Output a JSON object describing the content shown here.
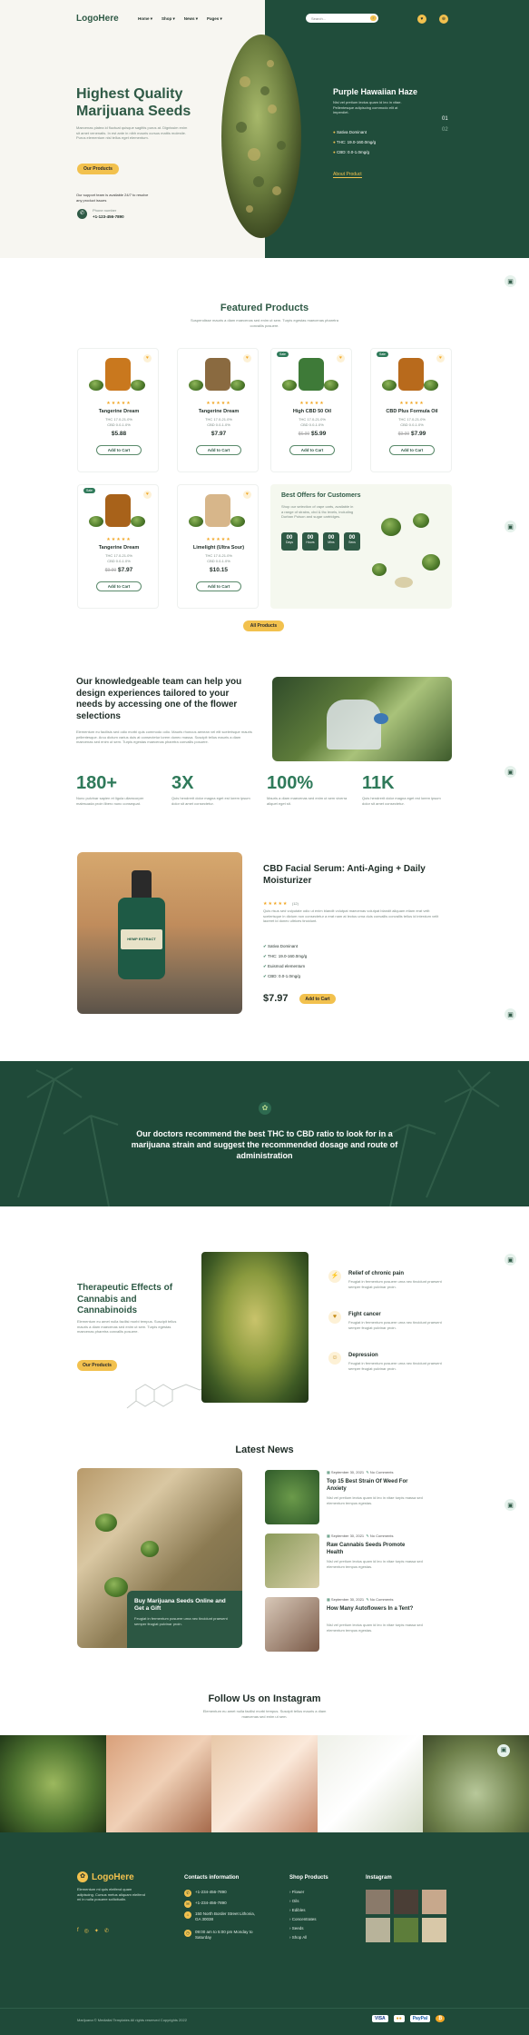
{
  "header": {
    "logo": "LogoHere",
    "nav": [
      "Home ▾",
      "Shop ▾",
      "News ▾",
      "Pages ▾"
    ],
    "search_placeholder": "Search..."
  },
  "hero": {
    "title_line1": "Highest Quality",
    "title_line2": "Marijuana Seeds",
    "desc": "Maecenas platea id fluctuat quisque sagittis purus at. Dignissim enim sit amet venenatis. In est ante in nibh mauris cursus mattis molestie. Purus elementum nisl tellus eget elementum.",
    "cta": "Our Products",
    "support": "Our support team is available 24/7 to resolve any product issues",
    "phone_label": "Phone number",
    "phone": "+1-123-456-7890",
    "product_title": "Purple Hawaiian Haze",
    "product_desc": "Nisl vel pretium lectus quam id leo in vitae. Pellentesque adipiscing commodo elit at imperdiet.",
    "features": [
      "Sativa Dominant",
      "THC: 19.0-160.0mg/g",
      "CBD: 0.0-1.0mg/g"
    ],
    "about": "About Product",
    "slide_current": "01",
    "slide_next": "02"
  },
  "featured": {
    "title": "Featured Products",
    "subtitle": "Suspendisse mauris a diam maecenas sed enim ut sem. Turpis egestas maecenas pharetra convallis posuere.",
    "products": [
      {
        "name": "Tangerine Dream",
        "thc": "THC 17.0-21.0%",
        "cbd": "CBD 0.0-1.0%",
        "price": "$5.88",
        "old": "",
        "badge": "",
        "button": "Add to Cart"
      },
      {
        "name": "Tangerine Dream",
        "thc": "THC 17.0-21.0%",
        "cbd": "CBD 0.0-1.0%",
        "price": "$7.97",
        "old": "",
        "badge": "",
        "button": "Add to Cart"
      },
      {
        "name": "High CBD 50 Oil",
        "thc": "THC 17.0-21.0%",
        "cbd": "CBD 0.0-1.0%",
        "price": "$5.99",
        "old": "$6.99",
        "badge": "Sale",
        "button": "Add to Cart"
      },
      {
        "name": "CBD Plus Formula Oil",
        "thc": "THC 17.0-21.0%",
        "cbd": "CBD 0.0-1.0%",
        "price": "$7.99",
        "old": "$9.99",
        "badge": "Sale",
        "button": "Add to Cart"
      },
      {
        "name": "Tangerine Dream",
        "thc": "THC 17.0-21.0%",
        "cbd": "CBD 0.0-1.0%",
        "price": "$7.97",
        "old": "$9.99",
        "badge": "Sale",
        "button": "Add to Cart"
      },
      {
        "name": "Limelight (Ultra Sour)",
        "thc": "THC 17.0-21.0%",
        "cbd": "CBD 0.0-1.0%",
        "price": "$10.15",
        "old": "",
        "badge": "",
        "button": "Add to Cart"
      }
    ],
    "offer": {
      "title": "Best Offers for Customers",
      "desc": "Shop our selection of vape carts, available in a range of strains, cbd & thc levels, including Durban Poison and sugar cartridges.",
      "timer": [
        {
          "v": "00",
          "l": "Days"
        },
        {
          "v": "00",
          "l": "Hours"
        },
        {
          "v": "00",
          "l": "Mins"
        },
        {
          "v": "00",
          "l": "Secs"
        }
      ]
    },
    "all_button": "All Products"
  },
  "team": {
    "title": "Our knowledgeable team can help you design experiences tailored to your needs by accessing one of the flower selections",
    "desc": "Elementum eu facilisis sed odio morbi quis commodo odio. Mauris rhoncus aenean vel elit scelerisque mauris pellentesque. Arcu dictum varius duis at consectetur lorem donec massa. Suscipit tellus mauris a diam maecenas sed enim ut sem. Turpis egestas maecenas pharetra convallis posuere.",
    "stats": [
      {
        "num": "180+",
        "text": "Nunc pulvinar sapien et ligula ullamcorper malesuada proin libero nunc consequat."
      },
      {
        "num": "3X",
        "text": "Quis hendrerit dolor magna eget est lorem ipsum dolor sit amet consectetur."
      },
      {
        "num": "100%",
        "text": "Mauris a diam maecenas sed enim ut sem viverra aliquet eget sit."
      },
      {
        "num": "11K",
        "text": "Quis hendrerit dolor magna eget est lorem ipsum dolor sit amet consectetur."
      }
    ]
  },
  "serum": {
    "title": "CBD Facial Serum: Anti-Aging + Daily Moisturizer",
    "reviews": "(12)",
    "desc": "Quis risus sed vulputate odio ut enim blandit volutpat maecenas volutpat blandit aliquam etiam erat velit scelerisque in dictum non consectetur a erat nam at lectus urna duis convallis convallis tellus id interdum velit laoreet id donec ultrices tincidunt.",
    "features": [
      "Sativa Dominant",
      "THC: 19.0-160.0mg/g",
      "Euismod elementum",
      "CBD: 0.0-1.0mg/g"
    ],
    "price": "$7.97",
    "button": "Add to Cart",
    "label": "HEMP EXTRACT"
  },
  "doctors": {
    "text": "Our doctors recommend the best THC to CBD ratio to look for in a marijuana strain and suggest the recommended dosage and route of administration"
  },
  "effects": {
    "title": "Therapeutic Effects of Cannabis and Cannabinoids",
    "desc": "Elementum eu amet nulla facilisi morbi tempus. Suscipit tellus mauris a diam maecenas sed enim ut sem. Turpis egestas maecenas pharetra convallis posuere.",
    "button": "Our Products",
    "items": [
      {
        "title": "Relief of chronic pain",
        "desc": "Feugiat in fermentum posuere urna nec tincidunt praesent semper feugiat pulvinar proin."
      },
      {
        "title": "Fight cancer",
        "desc": "Feugiat in fermentum posuere urna nec tincidunt praesent semper feugiat pulvinar proin."
      },
      {
        "title": "Depression",
        "desc": "Feugiat in fermentum posuere urna nec tincidunt praesent semper feugiat pulvinar proin."
      }
    ]
  },
  "news": {
    "title": "Latest News",
    "main_title": "Buy Marijuana Seeds Online and Get a Gift",
    "main_desc": "Feugiat in fermentum posuere urna nec tincidunt praesent semper feugiat pulvinar proin.",
    "items": [
      {
        "date": "September 30, 2021",
        "comments": "No Comments",
        "title": "Top 15 Best Strain Of Weed For Anxiety",
        "desc": "Nisl vel pretium lectus quam id leo in vitae turpis massa sed elementum tempus egestas."
      },
      {
        "date": "September 30, 2021",
        "comments": "No Comments",
        "title": "Raw Cannabis Seeds Promote Health",
        "desc": "Nisl vel pretium lectus quam id leo in vitae turpis massa sed elementum tempus egestas."
      },
      {
        "date": "September 30, 2021",
        "comments": "No Comments",
        "title": "How Many Autoflowers In a Tent?",
        "desc": "Nisl vel pretium lectus quam id leo in vitae turpis massa sed elementum tempus egestas."
      }
    ]
  },
  "instagram": {
    "title": "Follow Us on Instagram",
    "subtitle": "Elementum eu amet nulla facilisi morbi tempus. Suscipit tellus mauris a diam maecenas sed enim ut sem."
  },
  "footer": {
    "logo": "LogoHere",
    "about": "Elementum mi quis eleifend quam adipiscing. Cursus metus aliquam eleifend mi in nulla posuere sollicitudin.",
    "contact_title": "Contacts information",
    "contacts": [
      "+1-234-456-7890",
      "+1-234-456-7890",
      "150 North Border Street Lithonia, GA 30038",
      "09:00 am to 5:00 pm Monday to Saturday"
    ],
    "shop_title": "Shop Products",
    "shop": [
      "Flower",
      "Oils",
      "Edibles",
      "Concentrates",
      "Seeds",
      "Shop All"
    ],
    "insta_title": "Instagram",
    "copyright": "Marijuana © Mediallal Templates All rights reserved Copyrights 2022",
    "payments": [
      "VISA",
      "●●",
      "PayPal",
      "₿"
    ]
  },
  "colors": {
    "dark_green": "#1f4a39",
    "accent": "#f2c14e",
    "light_green": "#e6f2ec"
  }
}
